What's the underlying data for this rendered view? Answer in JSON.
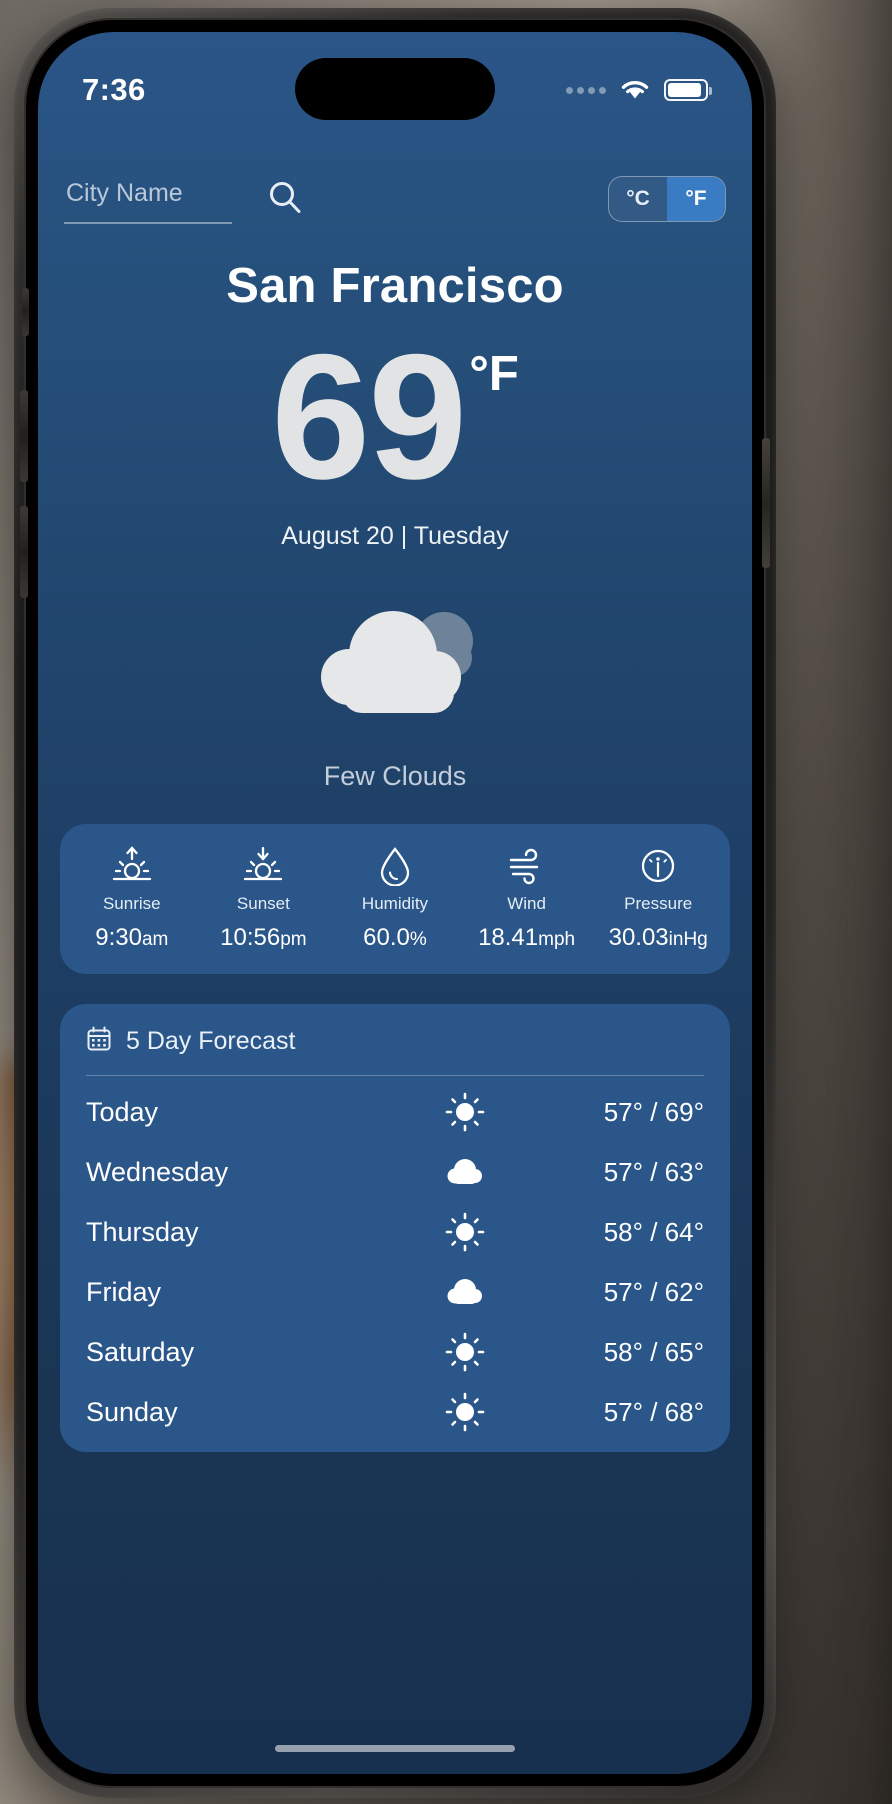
{
  "status_bar": {
    "time": "7:36",
    "signal_icon": "signal-dots-icon",
    "wifi_icon": "wifi-icon",
    "battery_icon": "battery-icon"
  },
  "search": {
    "placeholder": "City Name",
    "value": "",
    "search_icon": "search-icon"
  },
  "unit_toggle": {
    "celsius_label": "°C",
    "fahrenheit_label": "°F",
    "selected": "°F",
    "active_color": "#3a7cc4"
  },
  "current": {
    "city": "San Francisco",
    "temperature": "69",
    "unit": "°F",
    "date": "August 20 | Tuesday",
    "condition": "Few Clouds",
    "condition_icon": "few-clouds-icon"
  },
  "stats": [
    {
      "icon": "sunrise-icon",
      "label": "Sunrise",
      "value": "9:30",
      "suffix": "am"
    },
    {
      "icon": "sunset-icon",
      "label": "Sunset",
      "value": "10:56",
      "suffix": "pm"
    },
    {
      "icon": "humidity-icon",
      "label": "Humidity",
      "value": "60.0",
      "suffix": "%"
    },
    {
      "icon": "wind-icon",
      "label": "Wind",
      "value": "18.41",
      "suffix": "mph"
    },
    {
      "icon": "pressure-icon",
      "label": "Pressure",
      "value": "30.03",
      "suffix": "inHg"
    }
  ],
  "forecast": {
    "icon": "calendar-icon",
    "title": "5 Day Forecast",
    "rows": [
      {
        "day": "Today",
        "icon": "sun-icon",
        "temps": "57° / 69°"
      },
      {
        "day": "Wednesday",
        "icon": "cloud-icon",
        "temps": "57° / 63°"
      },
      {
        "day": "Thursday",
        "icon": "sun-icon",
        "temps": "58° / 64°"
      },
      {
        "day": "Friday",
        "icon": "cloud-icon",
        "temps": "57° / 62°"
      },
      {
        "day": "Saturday",
        "icon": "sun-icon",
        "temps": "58° / 65°"
      },
      {
        "day": "Sunday",
        "icon": "sun-icon",
        "temps": "57° / 68°"
      }
    ]
  },
  "theme": {
    "screen_bg_top": "#2a5587",
    "screen_bg_bottom": "#183050",
    "card_bg": "#2b5689",
    "temp_color": "#e1e3e5",
    "muted_text": "#c4cedb"
  }
}
